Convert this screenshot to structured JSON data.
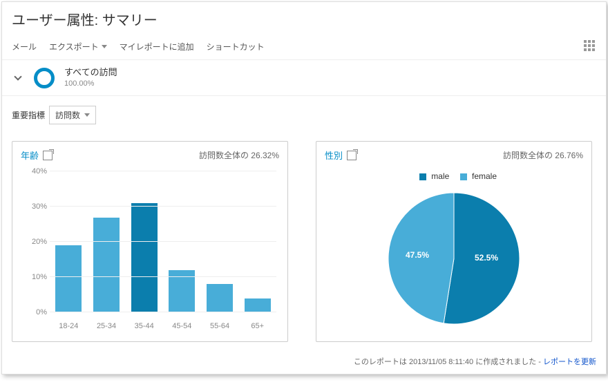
{
  "header": {
    "title": "ユーザー属性: サマリー"
  },
  "toolbar": {
    "mail": "メール",
    "export": "エクスポート",
    "add_to_my_reports": "マイレポートに追加",
    "shortcut": "ショートカット"
  },
  "segment": {
    "name": "すべての訪問",
    "percent": "100.00%"
  },
  "metric": {
    "label": "重要指標",
    "selected": "訪問数"
  },
  "panels": {
    "age": {
      "title": "年齢",
      "right_text": "訪問数全体の 26.32%"
    },
    "gender": {
      "title": "性別",
      "right_text": "訪問数全体の 26.76%",
      "legend_male": "male",
      "legend_female": "female",
      "male_pct_label": "52.5%",
      "female_pct_label": "47.5%"
    }
  },
  "footer": {
    "prefix": "このレポートは ",
    "timestamp": "2013/11/05 8:11:40",
    "created_text": " に作成されました - ",
    "refresh_link": "レポートを更新"
  },
  "colors": {
    "male": "#0b7ead",
    "female": "#48add8",
    "bar": "#48add8",
    "bar_highlight": "#0b7ead"
  },
  "chart_data": [
    {
      "id": "age_bar",
      "type": "bar",
      "title": "年齢",
      "xlabel": "",
      "ylabel": "",
      "ylim": [
        0,
        40
      ],
      "y_ticks": [
        0,
        10,
        20,
        30,
        40
      ],
      "y_tick_labels": [
        "0%",
        "10%",
        "20%",
        "30%",
        "40%"
      ],
      "categories": [
        "18-24",
        "25-34",
        "35-44",
        "45-54",
        "55-64",
        "65+"
      ],
      "values": [
        19,
        27,
        31,
        12,
        8,
        4
      ],
      "highlight_index": 2,
      "note": "訪問数全体の 26.32%"
    },
    {
      "id": "gender_pie",
      "type": "pie",
      "title": "性別",
      "series": [
        {
          "name": "male",
          "value": 52.5,
          "color": "#0b7ead"
        },
        {
          "name": "female",
          "value": 47.5,
          "color": "#48add8"
        }
      ],
      "note": "訪問数全体の 26.76%"
    }
  ]
}
